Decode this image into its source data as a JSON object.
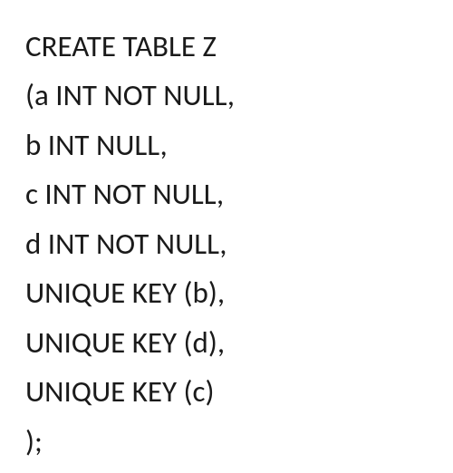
{
  "sql": {
    "lines": [
      "CREATE TABLE Z",
      "(a INT NOT NULL,",
      "b INT NULL,",
      "c INT NOT NULL,",
      "d INT NOT NULL,",
      "UNIQUE KEY (b),",
      "UNIQUE KEY (d),",
      "UNIQUE KEY (c)",
      ");"
    ]
  }
}
